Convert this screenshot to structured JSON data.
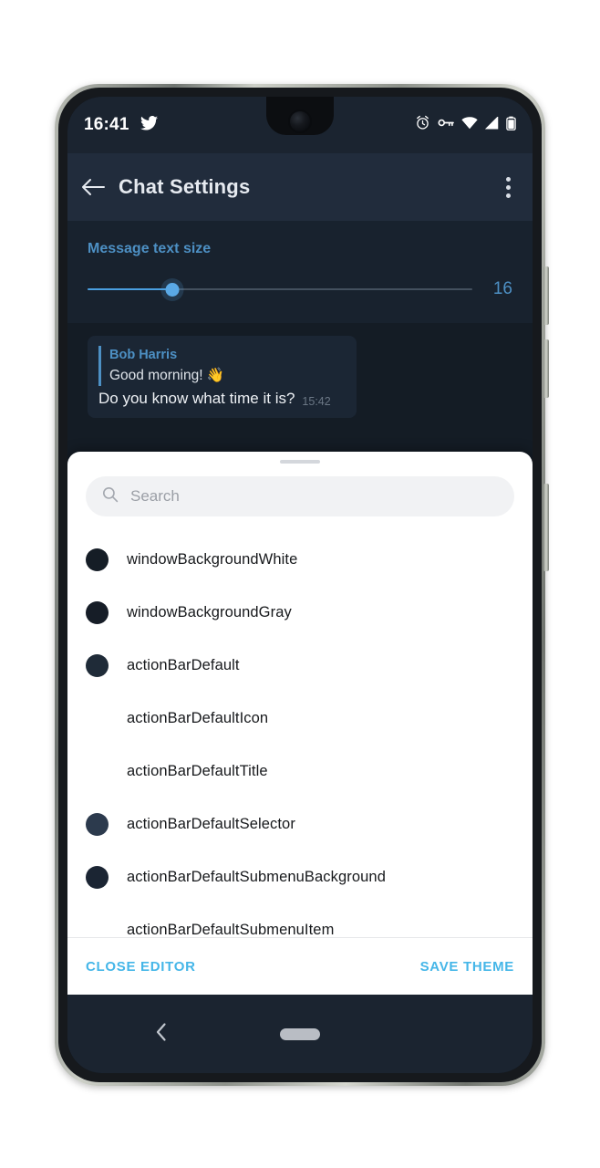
{
  "status_bar": {
    "time": "16:41",
    "notification_icon": "twitter-bird-icon",
    "icons": [
      "alarm-clock-icon",
      "vpn-key-icon",
      "wifi-icon",
      "cellular-signal-icon",
      "battery-icon"
    ]
  },
  "action_bar": {
    "back_icon": "back-arrow-icon",
    "title": "Chat Settings",
    "overflow_icon": "overflow-menu-icon"
  },
  "settings": {
    "text_size_label": "Message text size",
    "text_size_value": "16",
    "slider_percent": 22,
    "accent_color": "#4d90c4"
  },
  "chat_preview": {
    "reply_name": "Bob Harris",
    "reply_text": "Good morning! 👋",
    "message_text": "Do you know what time it is?",
    "timestamp": "15:42"
  },
  "sheet": {
    "search": {
      "placeholder": "Search",
      "icon": "search-icon",
      "value": ""
    },
    "items": [
      {
        "label": "windowBackgroundWhite",
        "color": "#151d26",
        "has_swatch": true
      },
      {
        "label": "windowBackgroundGray",
        "color": "#161d27",
        "has_swatch": true
      },
      {
        "label": "actionBarDefault",
        "color": "#1f2b38",
        "has_swatch": true
      },
      {
        "label": "actionBarDefaultIcon",
        "color": "#ffffff",
        "has_swatch": false
      },
      {
        "label": "actionBarDefaultTitle",
        "color": "#ffffff",
        "has_swatch": false
      },
      {
        "label": "actionBarDefaultSelector",
        "color": "#2c3a4d",
        "has_swatch": true
      },
      {
        "label": "actionBarDefaultSubmenuBackground",
        "color": "#1b2533",
        "has_swatch": true
      },
      {
        "label": "actionBarDefaultSubmenuItem",
        "color": "#ffffff",
        "has_swatch": false
      }
    ],
    "close_button": "CLOSE EDITOR",
    "save_button": "SAVE THEME",
    "button_color": "#45b6e8"
  },
  "nav_bar": {
    "back_icon": "nav-back-chevron-icon",
    "home_pill": "home-gesture-pill"
  }
}
